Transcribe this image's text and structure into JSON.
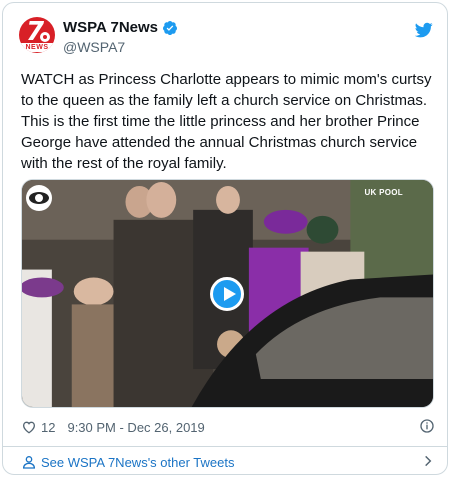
{
  "account": {
    "display_name": "WSPA 7News",
    "handle": "@WSPA7",
    "avatar_text": "7",
    "avatar_subtext": "NEWS",
    "verified": true
  },
  "tweet": {
    "text": "WATCH as Princess Charlotte appears to mimic mom's curtsy to the queen as the family left a church service on Christmas. This is the first time the little princess and her brother Prince George have attended the annual Christmas church service with the rest of the royal family."
  },
  "media": {
    "watermark": "UK POOL",
    "network_logo_icon": "cbs-eye-icon",
    "play_icon": "play-icon"
  },
  "meta": {
    "like_count": "12",
    "timestamp": "9:30 PM - Dec 26, 2019"
  },
  "footer": {
    "link_text": "See WSPA 7News's other Tweets"
  },
  "icons": {
    "verified": "verified-badge-icon",
    "twitter": "twitter-bird-icon",
    "heart": "heart-icon",
    "info": "info-icon",
    "person": "person-icon",
    "chevron": "chevron-right-icon"
  },
  "colors": {
    "accent": "#1d9bf0",
    "link": "#1b74c5",
    "muted": "#536471",
    "border": "#cfd9de",
    "brand_red": "#d82027"
  }
}
